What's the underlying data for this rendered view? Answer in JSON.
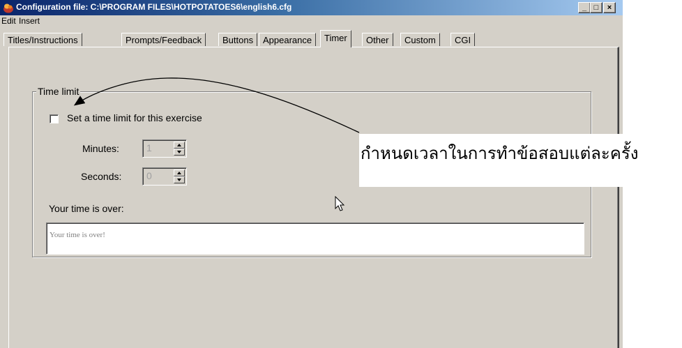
{
  "window": {
    "title": "Configuration file: C:\\PROGRAM FILES\\HOTPOTATOES6\\english6.cfg",
    "minimize": "_",
    "maximize": "□",
    "close": "×",
    "icon": "hotpotatoes-app-icon"
  },
  "menu": {
    "edit": "Edit",
    "insert": "Insert"
  },
  "tabs": [
    {
      "label": "Titles/Instructions"
    },
    {
      "label": "Prompts/Feedback"
    },
    {
      "label": "Buttons"
    },
    {
      "label": "Appearance"
    },
    {
      "label": "Timer",
      "active": true
    },
    {
      "label": "Other"
    },
    {
      "label": "Custom"
    },
    {
      "label": "CGI"
    }
  ],
  "time_limit": {
    "group_label": "Time limit",
    "checkbox_label": "Set a time limit for this exercise",
    "checked": false,
    "minutes_label": "Minutes:",
    "minutes_value": "1",
    "seconds_label": "Seconds:",
    "seconds_value": "0",
    "time_over_label": "Your time is over:",
    "time_over_value": "Your time is over!"
  },
  "annotation": {
    "text": "กำหนดเวลาในการทำข้อสอบแต่ละครั้ง"
  },
  "colors": {
    "face": "#d4d0c8",
    "title_start": "#0a246a",
    "title_end": "#a6caf0"
  }
}
